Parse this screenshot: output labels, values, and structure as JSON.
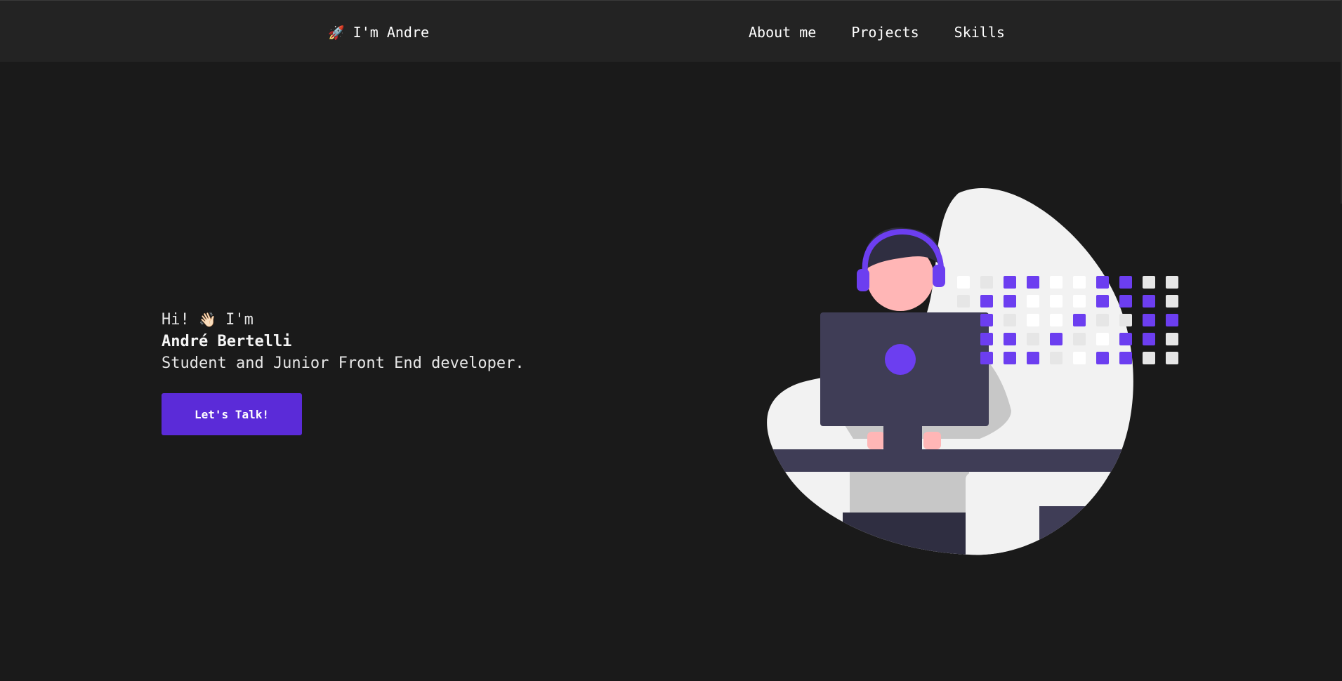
{
  "nav": {
    "brand_icon": "rocket-icon",
    "brand_emoji": "🚀",
    "brand_label": "I'm Andre",
    "links": [
      {
        "label": "About me"
      },
      {
        "label": "Projects"
      },
      {
        "label": "Skills"
      }
    ]
  },
  "hero": {
    "greeting_prefix": "Hi!",
    "wave_emoji": "👋🏻",
    "greeting_suffix": "I'm",
    "name": "André Bertelli",
    "tagline": "Student and Junior Front End developer.",
    "cta_label": "Let's Talk!"
  },
  "colors": {
    "background": "#1a1a1a",
    "navbar": "#232323",
    "accent": "#5b2bd8",
    "illustration_purple": "#6c3ef0"
  }
}
